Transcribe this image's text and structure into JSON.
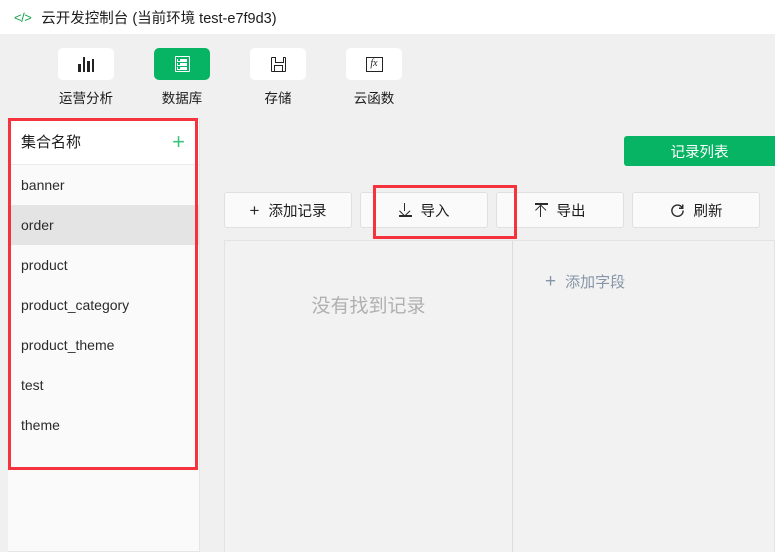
{
  "titlebar": {
    "icon": "code-brackets-icon",
    "title": "云开发控制台（当前环境 test-e7f9d3）",
    "title_display": "云开发控制台 (当前环境 test-e7f9d3)"
  },
  "nav": {
    "items": [
      {
        "label": "运营分析",
        "icon": "bar-chart-icon",
        "active": false
      },
      {
        "label": "数据库",
        "icon": "database-list-icon",
        "active": true
      },
      {
        "label": "存储",
        "icon": "floppy-save-icon",
        "active": false
      },
      {
        "label": "云函数",
        "icon": "fx-function-icon",
        "active": false
      }
    ]
  },
  "sidebar": {
    "header_title": "集合名称",
    "add_icon": "plus-icon",
    "collections": [
      {
        "name": "banner",
        "selected": false
      },
      {
        "name": "order",
        "selected": true
      },
      {
        "name": "product",
        "selected": false
      },
      {
        "name": "product_category",
        "selected": false
      },
      {
        "name": "product_theme",
        "selected": false
      },
      {
        "name": "test",
        "selected": false
      },
      {
        "name": "theme",
        "selected": false
      }
    ]
  },
  "right": {
    "record_tab_label": "记录列表",
    "toolbar": [
      {
        "label": "添加记录",
        "icon": "plus-icon"
      },
      {
        "label": "导入",
        "icon": "download-arrow-icon",
        "highlighted": true
      },
      {
        "label": "导出",
        "icon": "upload-arrow-icon"
      },
      {
        "label": "刷新",
        "icon": "refresh-icon"
      }
    ],
    "empty_state_text": "没有找到记录",
    "add_field_label": "添加字段",
    "add_field_icon": "plus-icon"
  },
  "annotations": [
    {
      "name": "sidebar-highlight",
      "color": "#f5333f"
    },
    {
      "name": "import-button-highlight",
      "color": "#f5333f"
    }
  ],
  "colors": {
    "brand_green": "#07b464",
    "annotation_red": "#f5333f",
    "page_bg": "#f0f0f0",
    "selected_row": "#e4e4e4",
    "muted_text": "#b0b0b0",
    "addfield_text": "#8795a8"
  }
}
